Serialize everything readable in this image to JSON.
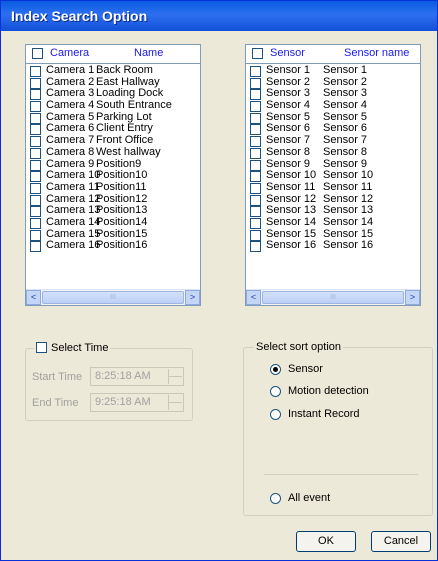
{
  "window": {
    "title": "Index Search Option"
  },
  "camera_list": {
    "header": [
      "Camera",
      "Name"
    ],
    "rows": [
      [
        "Camera 1",
        "Back Room"
      ],
      [
        "Camera 2",
        "East Hallway"
      ],
      [
        "Camera 3",
        "Loading Dock"
      ],
      [
        "Camera 4",
        "South Entrance"
      ],
      [
        "Camera 5",
        "Parking Lot"
      ],
      [
        "Camera 6",
        "Client Entry"
      ],
      [
        "Camera 7",
        "Front Office"
      ],
      [
        "Camera 8",
        "West hallway"
      ],
      [
        "Camera 9",
        "Position9"
      ],
      [
        "Camera 10",
        "Position10"
      ],
      [
        "Camera 11",
        "Position11"
      ],
      [
        "Camera 12",
        "Position12"
      ],
      [
        "Camera 13",
        "Position13"
      ],
      [
        "Camera 14",
        "Position14"
      ],
      [
        "Camera 15",
        "Position15"
      ],
      [
        "Camera 16",
        "Position16"
      ]
    ]
  },
  "sensor_list": {
    "header": [
      "Sensor",
      "Sensor name"
    ],
    "rows": [
      [
        "Sensor 1",
        "Sensor 1"
      ],
      [
        "Sensor 2",
        "Sensor 2"
      ],
      [
        "Sensor 3",
        "Sensor 3"
      ],
      [
        "Sensor 4",
        "Sensor 4"
      ],
      [
        "Sensor 5",
        "Sensor 5"
      ],
      [
        "Sensor 6",
        "Sensor 6"
      ],
      [
        "Sensor 7",
        "Sensor 7"
      ],
      [
        "Sensor 8",
        "Sensor 8"
      ],
      [
        "Sensor 9",
        "Sensor 9"
      ],
      [
        "Sensor 10",
        "Sensor 10"
      ],
      [
        "Sensor 11",
        "Sensor 11"
      ],
      [
        "Sensor 12",
        "Sensor 12"
      ],
      [
        "Sensor 13",
        "Sensor 13"
      ],
      [
        "Sensor 14",
        "Sensor 14"
      ],
      [
        "Sensor 15",
        "Sensor 15"
      ],
      [
        "Sensor 16",
        "Sensor 16"
      ]
    ]
  },
  "scroll": {
    "left_glyph": "<",
    "right_glyph": ">",
    "thumb_grip": "III"
  },
  "select_time": {
    "label": "Select Time",
    "checked": false,
    "start_label": "Start Time",
    "start_value": "8:25:18 AM",
    "end_label": "End Time",
    "end_value": "9:25:18 AM"
  },
  "sort": {
    "legend": "Select sort option",
    "options": [
      "Sensor",
      "Motion detection",
      "Instant Record"
    ],
    "selected": "Sensor",
    "all_event": "All event"
  },
  "buttons": {
    "ok": "OK",
    "cancel": "Cancel"
  },
  "colors": {
    "title_bar": "#1150d8",
    "header_text": "#1a1ae6",
    "dialog_bg": "#ece9d8"
  }
}
